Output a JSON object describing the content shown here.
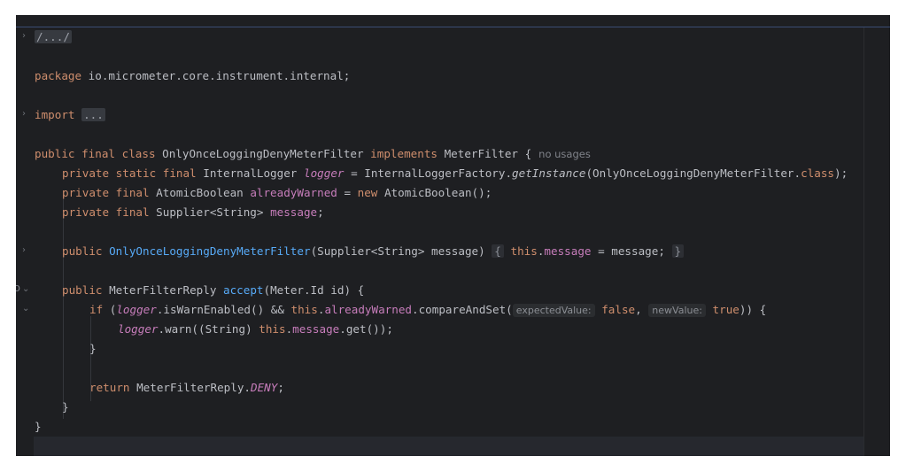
{
  "code": {
    "header_fold": "/.../",
    "package_kw": "package",
    "package_name": " io.micrometer.core.instrument.internal;",
    "import_kw": "import",
    "import_fold": "...",
    "class_line": {
      "kw1": "public",
      "kw2": "final",
      "kw3": "class",
      "name": " OnlyOnceLoggingDenyMeterFilter ",
      "kw4": "implements",
      "iface": " MeterFilter {",
      "usage": "no usages"
    },
    "field1": {
      "kw": "private static final",
      "type": " InternalLogger ",
      "name": "logger",
      "eq": " = InternalLoggerFactory.",
      "method": "getInstance",
      "args": "(OnlyOnceLoggingDenyMeterFilter.",
      "classkw": "class",
      "end": ");"
    },
    "field2": {
      "kw": "private final",
      "type": " AtomicBoolean ",
      "name": "alreadyWarned",
      "eq": " = ",
      "newkw": "new",
      "rest": " AtomicBoolean();"
    },
    "field3": {
      "kw": "private final",
      "type": " Supplier<String> ",
      "name": "message",
      "end": ";"
    },
    "ctor": {
      "kw": "public",
      "name": "OnlyOnceLoggingDenyMeterFilter",
      "params": "(Supplier<String> message)",
      "open": "{",
      "this_kw": "this",
      "dot": ".",
      "field": "message",
      "rest": " = message;",
      "close": "}"
    },
    "accept": {
      "kw": "public",
      "type": " MeterFilterReply ",
      "name": "accept",
      "params": "(Meter.Id id) {"
    },
    "if_line": {
      "kw": "if",
      "open": " (",
      "logger": "logger",
      "call1": ".isWarnEnabled() && ",
      "this_kw": "this",
      "dot": ".",
      "field": "alreadyWarned",
      "call2": ".compareAndSet(",
      "hint1": "expectedValue:",
      "false_kw": "false",
      "comma": ", ",
      "hint2": "newValue:",
      "true_kw": "true",
      "end": ")) {"
    },
    "warn_line": {
      "logger": "logger",
      "call": ".warn((String) ",
      "this_kw": "this",
      "dot": ".",
      "field": "message",
      "end": ".get());"
    },
    "close_if": "}",
    "return_line": {
      "kw": "return",
      "type": " MeterFilterReply.",
      "const": "DENY",
      "end": ";"
    },
    "close_method": "}",
    "close_class": "}"
  },
  "icons": [
    "chevron-right-icon",
    "chevron-down-icon",
    "implementation-marker-icon"
  ],
  "colors": {
    "background": "#1e1f22",
    "keyword": "#cf8e6d",
    "field": "#c77dbb",
    "method_decl": "#57aaf7",
    "text": "#bcbec4"
  }
}
